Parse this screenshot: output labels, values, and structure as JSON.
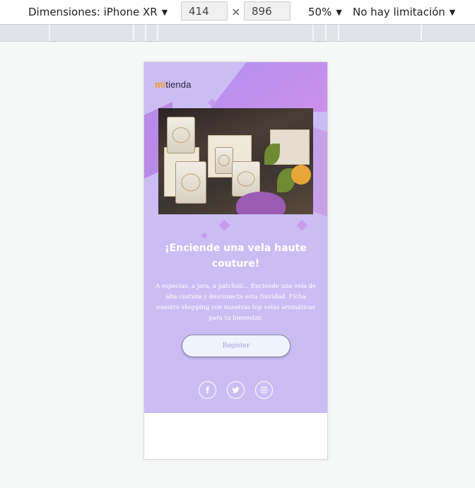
{
  "toolbar": {
    "device_label": "Dimensiones: iPhone XR",
    "width_value": "414",
    "height_value": "896",
    "times_symbol": "×",
    "zoom_label": "50%",
    "throttle_label": "No hay limitación",
    "caret": "▼"
  },
  "email": {
    "logo_prefix": "mi",
    "logo_suffix": "tienda",
    "headline": "¡Enciende una vela haute couture!",
    "body": "A especias, a jara, a patchulí... Enciende una vela de alta costura y desconecta esta Navidad. Ficha nuestro shopping con nuestras top velas aromáticas para tu bienestar.",
    "cta_label": "Register",
    "social_icons": [
      "facebook-icon",
      "twitter-icon",
      "instagram-icon"
    ]
  },
  "colors": {
    "hero_bg": "#cbbdf4",
    "accent_orange": "#f59a23",
    "cta_bg": "#eef3fe",
    "cta_text": "#a99bdc"
  }
}
